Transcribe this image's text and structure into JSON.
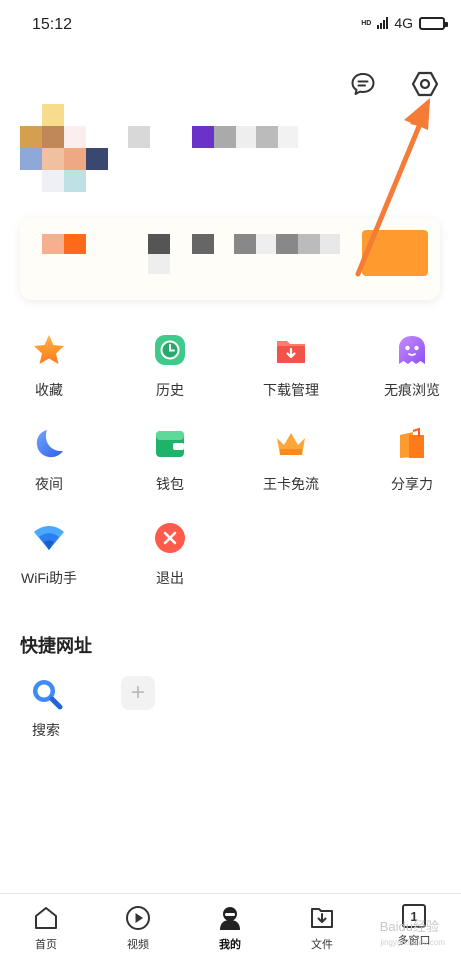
{
  "status_bar": {
    "time": "15:12",
    "hd": "HD",
    "network": "4G"
  },
  "top_actions": {
    "message_icon": "message-bubble-icon",
    "settings_icon": "settings-hexagon-icon"
  },
  "colors": {
    "arrow": "#f47c36",
    "accent": "#ff9a2e"
  },
  "menu": [
    {
      "label": "收藏",
      "icon": "star-icon"
    },
    {
      "label": "历史",
      "icon": "clock-icon"
    },
    {
      "label": "下载管理",
      "icon": "download-folder-icon"
    },
    {
      "label": "无痕浏览",
      "icon": "ghost-icon"
    },
    {
      "label": "夜间",
      "icon": "moon-icon"
    },
    {
      "label": "钱包",
      "icon": "wallet-icon"
    },
    {
      "label": "王卡免流",
      "icon": "crown-icon"
    },
    {
      "label": "分享力",
      "icon": "share-icon"
    },
    {
      "label": "WiFi助手",
      "icon": "wifi-icon"
    },
    {
      "label": "退出",
      "icon": "close-icon"
    }
  ],
  "shortcuts": {
    "title": "快捷网址",
    "items": [
      {
        "label": "搜索",
        "icon": "search-icon"
      }
    ],
    "add_icon": "plus-icon"
  },
  "bottom_nav": [
    {
      "label": "首页",
      "icon": "home-icon"
    },
    {
      "label": "视频",
      "icon": "play-icon"
    },
    {
      "label": "我的",
      "icon": "user-icon",
      "active": true
    },
    {
      "label": "文件",
      "icon": "file-download-icon"
    },
    {
      "label": "多窗口",
      "icon": "window-count-icon",
      "count": "1"
    }
  ],
  "watermark": {
    "text": "Baidu经验",
    "sub": "jingyan.baidu.com"
  }
}
